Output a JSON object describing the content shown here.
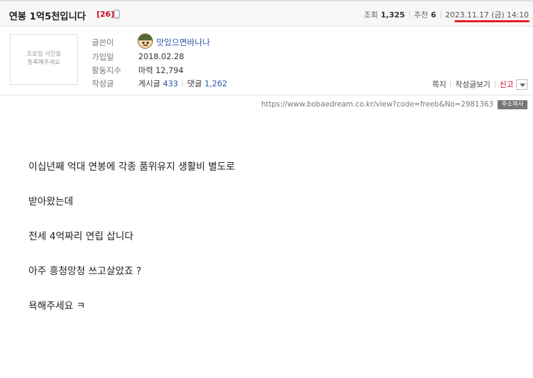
{
  "post": {
    "title": "연봉 1억5천입니다",
    "comment_count": "[26]",
    "device_icon": "mobile-phone-icon"
  },
  "stats": {
    "views_label": "조회",
    "views_value": "1,325",
    "recommend_label": "추천",
    "recommend_value": "6",
    "date": "2023.11.17 (금) 14:10",
    "highlight_color": "#e01e28"
  },
  "profile": {
    "photo_placeholder_line1": "프로필 사진을",
    "photo_placeholder_line2": "등록해주세요",
    "author_label": "글쓴이",
    "author_name": "맛있으면바나나",
    "joined_label": "가입일",
    "joined_value": "2018.02.28",
    "activity_label": "활동지수",
    "activity_value": "마력 12,794",
    "posts_label": "작성글",
    "posts_prefix": "게시글",
    "posts_count": "433",
    "comments_prefix": "댓글",
    "comments_count": "1,262"
  },
  "actions": {
    "message": "쪽지",
    "view_posts": "작성글보기",
    "report": "신고"
  },
  "url": {
    "text": "https://www.bobaedream.co.kr/view?code=freeb&No=2981363",
    "copy_button": "주소복사"
  },
  "content": {
    "lines": [
      "이십년째 억대 연봉에 각종 품위유지 생활비 별도로",
      "받아왔는데",
      "전세 4억짜리 연립 삽니다",
      "아주 흥청망청 쓰고살았죠 ?",
      "욕해주세요 ㅋ"
    ]
  }
}
